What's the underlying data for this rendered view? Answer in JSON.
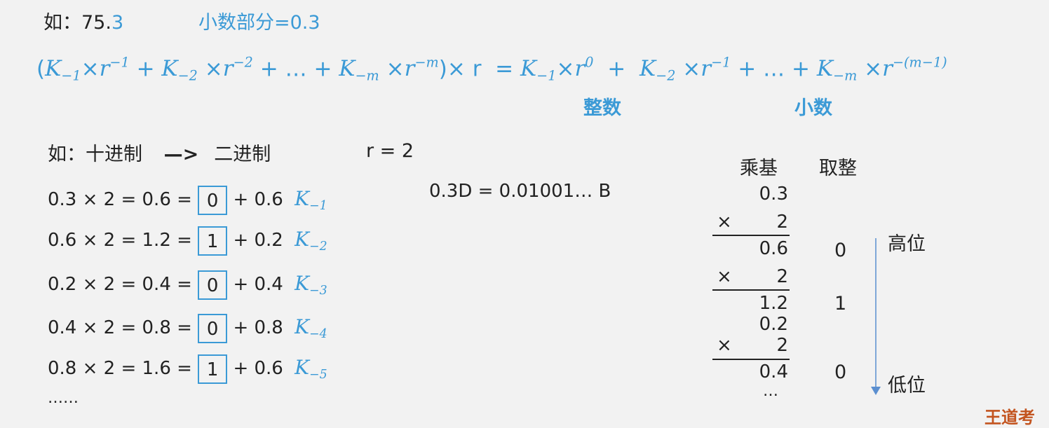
{
  "example": {
    "prefix": "如：",
    "int_part": "75.",
    "frac_digit": "3",
    "frac_label": "小数部分=0.3"
  },
  "formula": {
    "lhs_open": "(",
    "k1": "K",
    "k1_sub": "−1",
    "times": "×",
    "r": "r",
    "p1": "−1",
    "k2_sub": "−2",
    "p2": "−2",
    "plus": "+",
    "ellipsis": "…",
    "km_sub": "−m",
    "pm": "−m",
    "lhs_close": ")× r",
    "eq": "=",
    "p0": "0",
    "pm1": "−(m−1)",
    "int_label": "整数",
    "frac_label": "小数"
  },
  "convert": {
    "prefix": "如：",
    "from": "十进制",
    "arrow": "—>",
    "to": "二进制",
    "radix": "r = 2"
  },
  "rows": [
    {
      "lhs": "0.3 × 2  =  0.6  =",
      "bit": "0",
      "rest": "+  0.6",
      "k": "K",
      "ksub": "−1"
    },
    {
      "lhs": "0.6 × 2  =  1.2  =",
      "bit": "1",
      "rest": "+  0.2",
      "k": "K",
      "ksub": "−2"
    },
    {
      "lhs": "0.2 × 2  =  0.4  =",
      "bit": "0",
      "rest": "+  0.4",
      "k": "K",
      "ksub": "−3"
    },
    {
      "lhs": "0.4 × 2  =  0.8  =",
      "bit": "0",
      "rest": "+  0.8",
      "k": "K",
      "ksub": "−4"
    },
    {
      "lhs": "0.8 × 2  =  1.6  =",
      "bit": "1",
      "rest": "+  0.6",
      "k": "K",
      "ksub": "−5"
    }
  ],
  "more": "……",
  "result": "0.3D = 0.01001… B",
  "vertical": {
    "col1_header": "乘基",
    "col2_header": "取整",
    "v1": "0.3",
    "mul": "×",
    "two": "2",
    "p1": "0.6",
    "d1": "0",
    "p2": "1.2",
    "d2": "1",
    "v3": "0.2",
    "p3": "0.4",
    "d3": "0",
    "dots": "…",
    "high": "高位",
    "low": "低位"
  },
  "watermark": "王道考"
}
